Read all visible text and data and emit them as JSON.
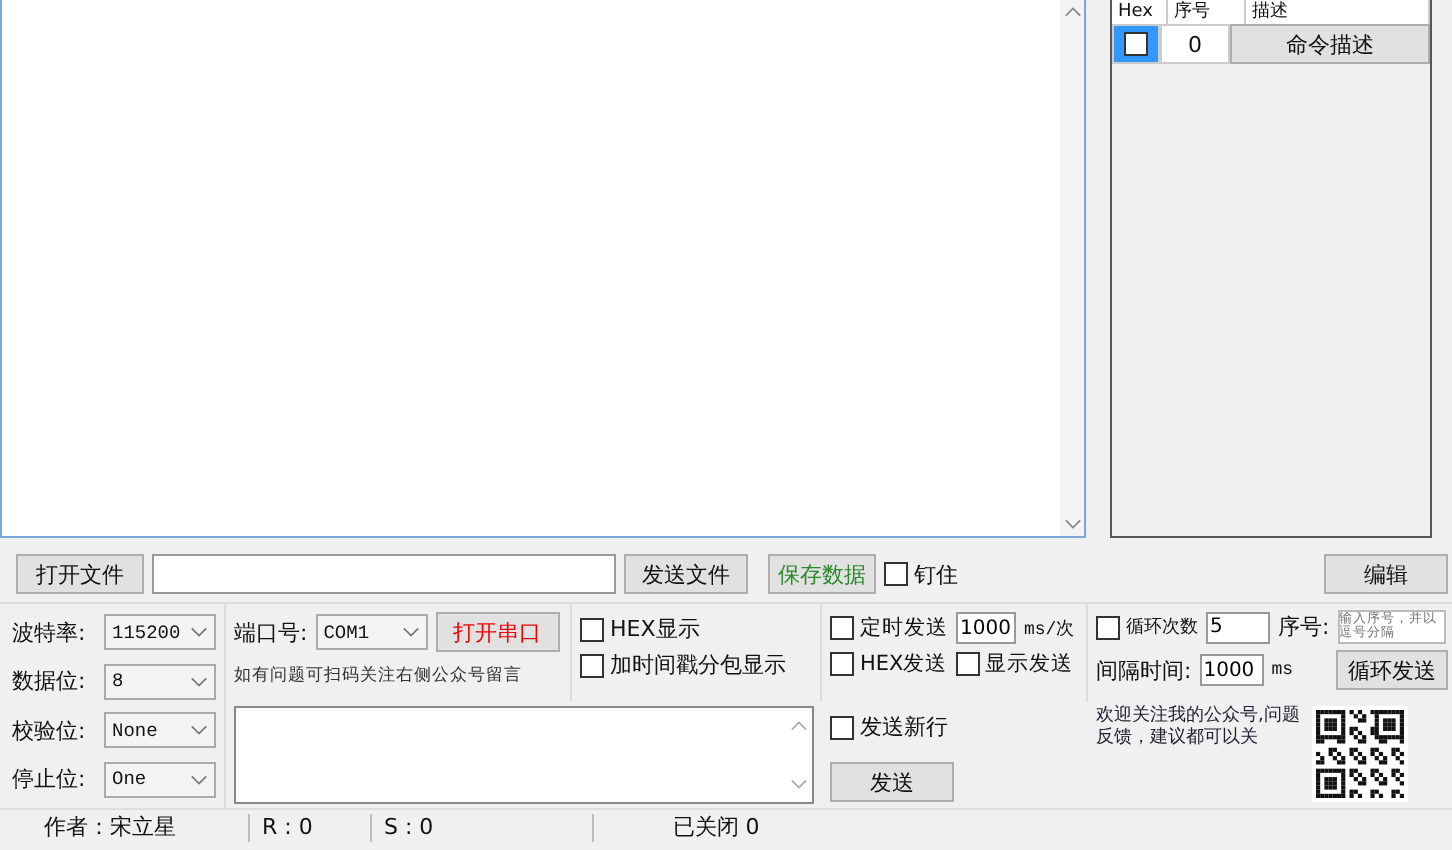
{
  "command_table": {
    "columns": [
      "Hex",
      "序号",
      "描述"
    ],
    "rows": [
      {
        "checked": false,
        "selected": true,
        "index": "0",
        "description": "命令描述"
      }
    ]
  },
  "file_bar": {
    "open_file_button": "打开文件",
    "send_file_button": "发送文件",
    "save_data_button": "保存数据",
    "pin": {
      "label": "钉住",
      "checked": false
    },
    "edit_button": "编辑"
  },
  "serial_settings": [
    {
      "label": "波特率:",
      "value": "115200"
    },
    {
      "label": "数据位:",
      "value": "8"
    },
    {
      "label": "校验位:",
      "value": "None"
    },
    {
      "label": "停止位:",
      "value": "One"
    }
  ],
  "port": {
    "label": "端口号:",
    "value": "COM1",
    "open_button": "打开串口",
    "hint": "如有问题可扫码关注右侧公众号留言"
  },
  "display_options": [
    {
      "label": "HEX显示",
      "checked": false
    },
    {
      "label": "加时间戳分包显示",
      "checked": false
    }
  ],
  "timed_send": {
    "label": "定时发送",
    "checked": false,
    "interval": "1000",
    "unit": "ms/次"
  },
  "send_options": [
    {
      "label": "HEX发送",
      "checked": false
    },
    {
      "label": "显示发送",
      "checked": false
    }
  ],
  "loop": {
    "label": "循环次数",
    "checked": false,
    "count": "5",
    "index_label": "序号:",
    "index_placeholder": "输入序号，并以逗号分隔",
    "interval_label": "间隔时间:",
    "interval": "1000",
    "unit": "ms",
    "button": "循环发送"
  },
  "send_panel": {
    "newline": {
      "label": "发送新行",
      "checked": false
    },
    "send_button": "发送"
  },
  "welcome": "欢迎关注我的公众号,问题反馈，建议都可以关",
  "status_bar": [
    "作者：宋立星",
    "R : 0",
    "S : 0",
    "已关闭 0"
  ]
}
